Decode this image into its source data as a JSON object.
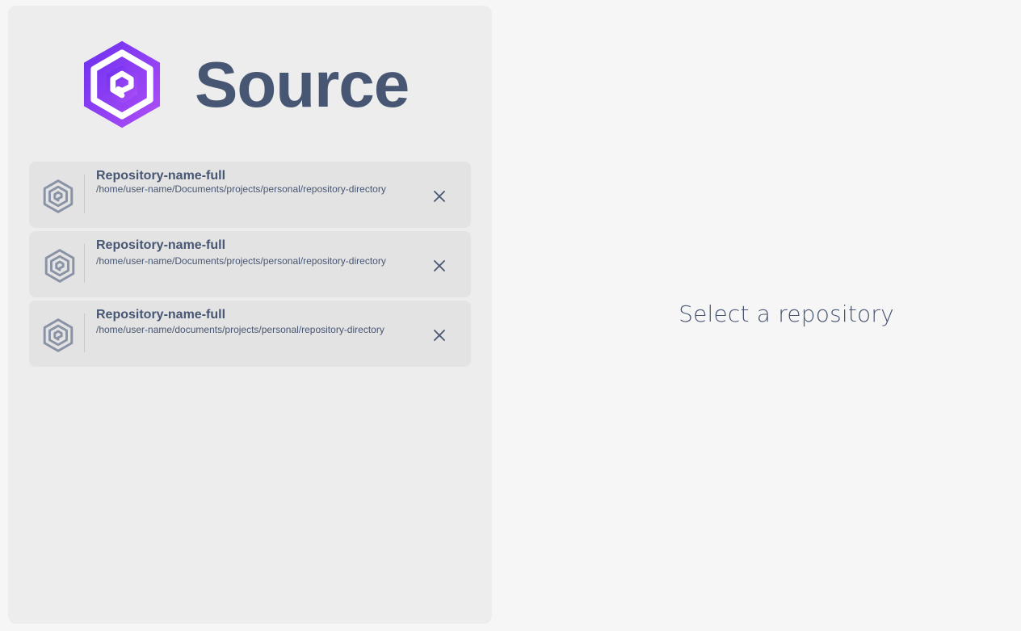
{
  "app": {
    "name": "Source",
    "accent_colors": [
      "#6b2ff0",
      "#a64ff5"
    ],
    "text_color": "#475672"
  },
  "repositories": [
    {
      "name": "Repository-name-full",
      "path": "/home/user-name/Documents/projects/personal/repository-directory",
      "icon": "source-logo-icon"
    },
    {
      "name": "Repository-name-full",
      "path": "/home/user-name/Documents/projects/personal/repository-directory",
      "icon": "source-logo-icon"
    },
    {
      "name": "Repository-name-full",
      "path": "/home/user-name/documents/projects/personal/repository-directory",
      "icon": "source-logo-icon"
    }
  ],
  "main": {
    "empty_message": "Select a repository"
  }
}
